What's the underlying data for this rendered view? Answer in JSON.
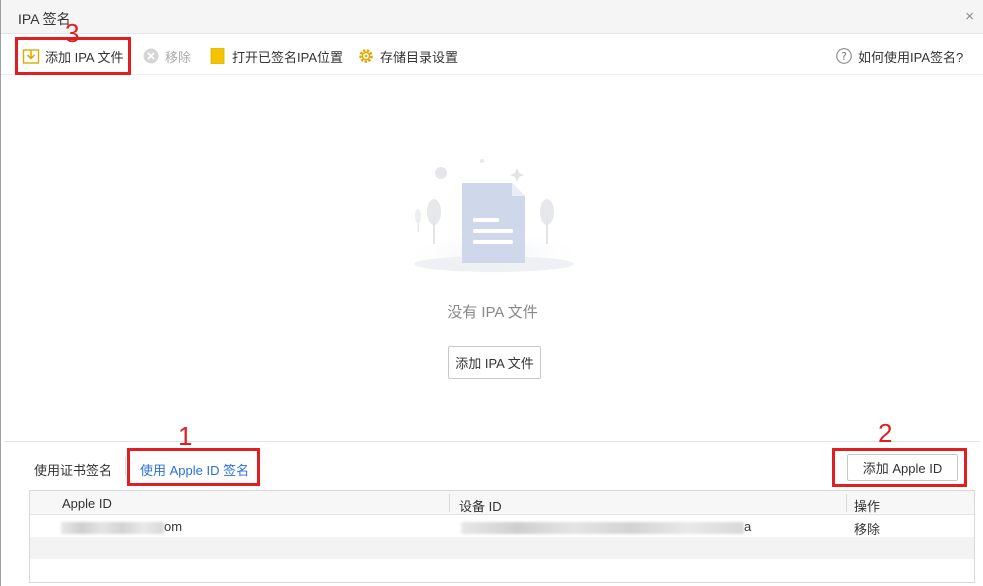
{
  "window": {
    "title": "IPA 签名",
    "close_glyph": "×"
  },
  "toolbar": {
    "add_ipa_label": "添加 IPA 文件",
    "remove_label": "移除",
    "open_signed_label": "打开已签名IPA位置",
    "storage_settings_label": "存储目录设置",
    "help_label": "如何使用IPA签名?"
  },
  "empty_state": {
    "message": "没有 IPA 文件",
    "button_label": "添加 IPA 文件"
  },
  "signing_tabs": {
    "cert_label": "使用证书签名",
    "apple_id_label": "使用 Apple ID 签名",
    "active": "apple_id"
  },
  "apple_id_panel": {
    "add_button_label": "添加 Apple ID",
    "columns": [
      "Apple ID",
      "设备 ID",
      "操作"
    ],
    "rows": [
      {
        "apple_id_suffix": "om",
        "device_id_suffix": "a",
        "action": "移除"
      }
    ]
  },
  "annotations": [
    {
      "number": "1",
      "target": "apple-id-tab"
    },
    {
      "number": "2",
      "target": "add-apple-id-button"
    },
    {
      "number": "3",
      "target": "add-ipa-toolbar-button"
    }
  ],
  "colors": {
    "accent_blue": "#2a6fe0",
    "annotation_red": "#e02020",
    "icon_yellow": "#f5c400",
    "illustration_blue": "#cfd8ea"
  },
  "icons": {
    "add_ipa": "add-file-icon",
    "remove": "remove-circle-icon",
    "open_folder": "folder-icon",
    "settings": "gear-icon",
    "help": "question-circle-icon"
  }
}
